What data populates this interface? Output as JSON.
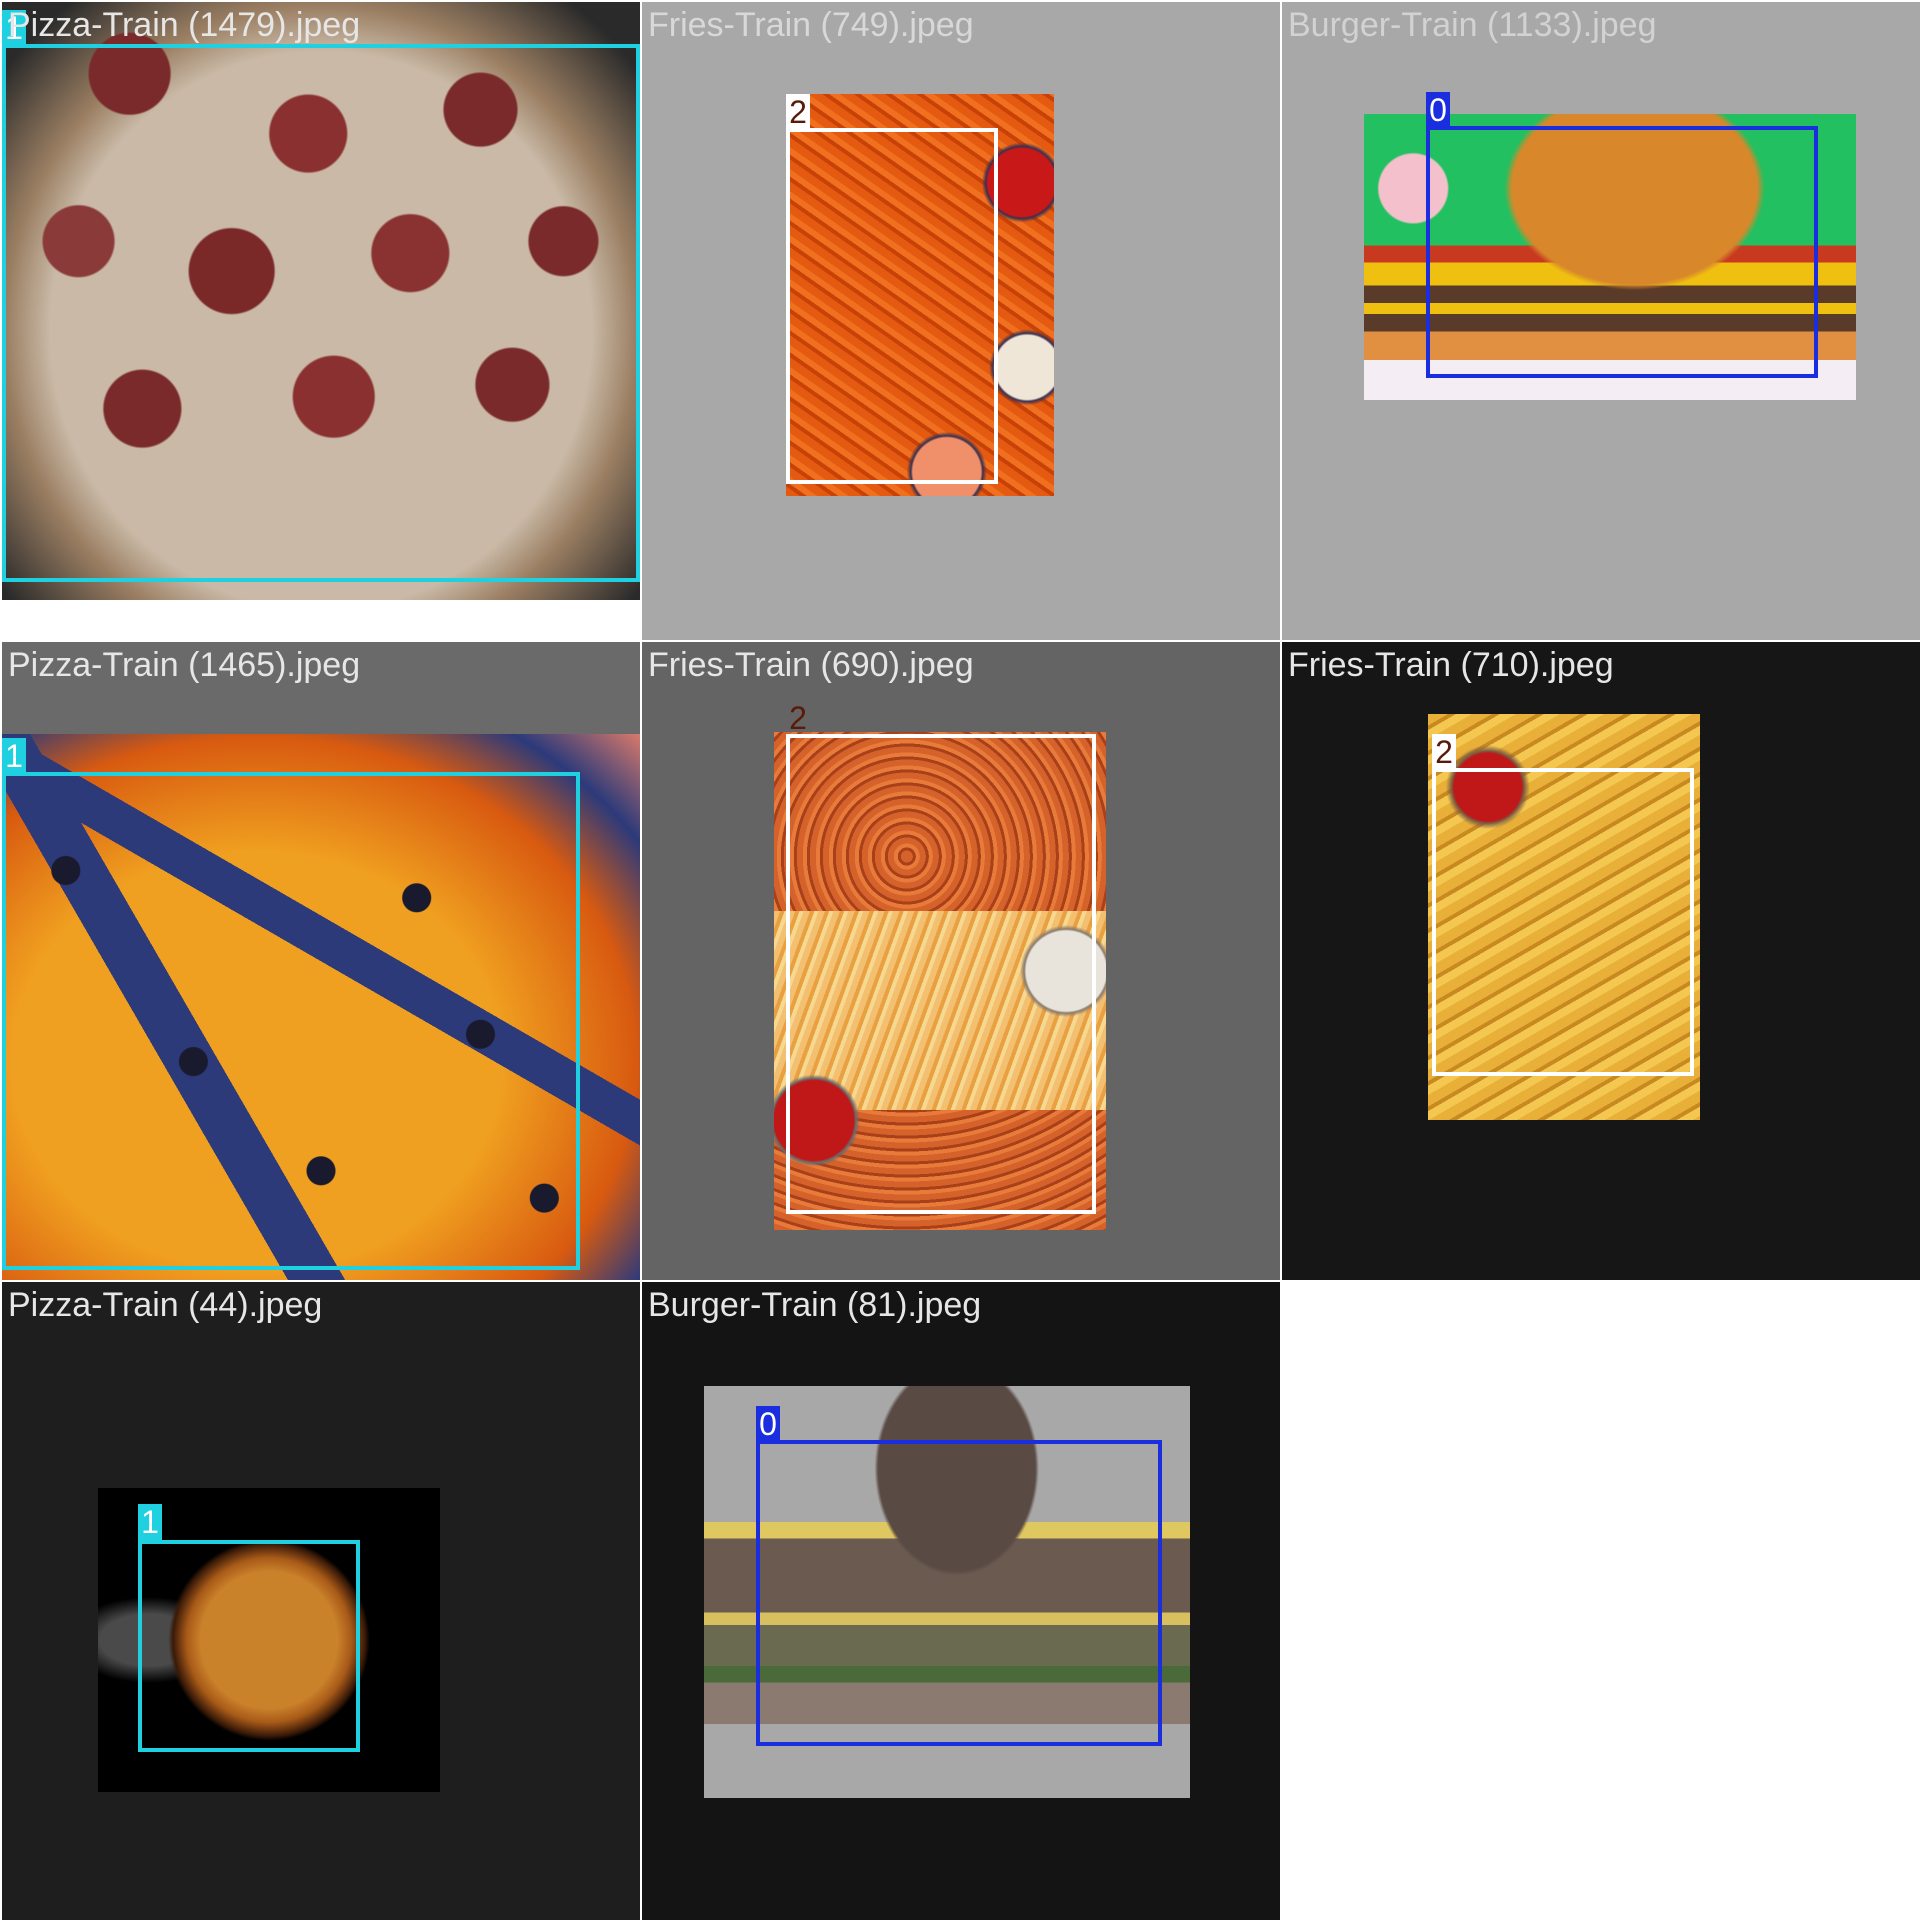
{
  "colors": {
    "class_0": "#1a2ee0",
    "class_1": "#1ed0e0",
    "class_2": "#ffffff",
    "title_on_light": "#d2d2d2",
    "title_on_dark": "#e6e6e6",
    "tag_on_light_text": "#ffffff",
    "tag_class2_text": "#5a1a0a"
  },
  "tiles": [
    {
      "title": "Pizza-Train (1479).jpeg",
      "background": "#3a3a3a",
      "label": "1",
      "photo": "pizza-pepperoni"
    },
    {
      "title": "Fries-Train (749).jpeg",
      "background": "#a8a8a8",
      "label": "2",
      "photo": "fries-sweet"
    },
    {
      "title": "Burger-Train (1133).jpeg",
      "background": "#a8a8a8",
      "label": "0",
      "photo": "burger-bacon"
    },
    {
      "title": "Pizza-Train (1465).jpeg",
      "background": "#6a6a6a",
      "label": "1",
      "photo": "pizza-veg"
    },
    {
      "title": "Fries-Train (690).jpeg",
      "background": "#646464",
      "label": "2",
      "photo": "fries-platter"
    },
    {
      "title": "Fries-Train (710).jpeg",
      "background": "#161616",
      "label": "2",
      "photo": "fries-classic"
    },
    {
      "title": "Pizza-Train (44).jpeg",
      "background": "#1e1e1e",
      "label": "1",
      "photo": "pizza-small"
    },
    {
      "title": "Burger-Train (81).jpeg",
      "background": "#141414",
      "label": "0",
      "photo": "burger-dark"
    }
  ]
}
